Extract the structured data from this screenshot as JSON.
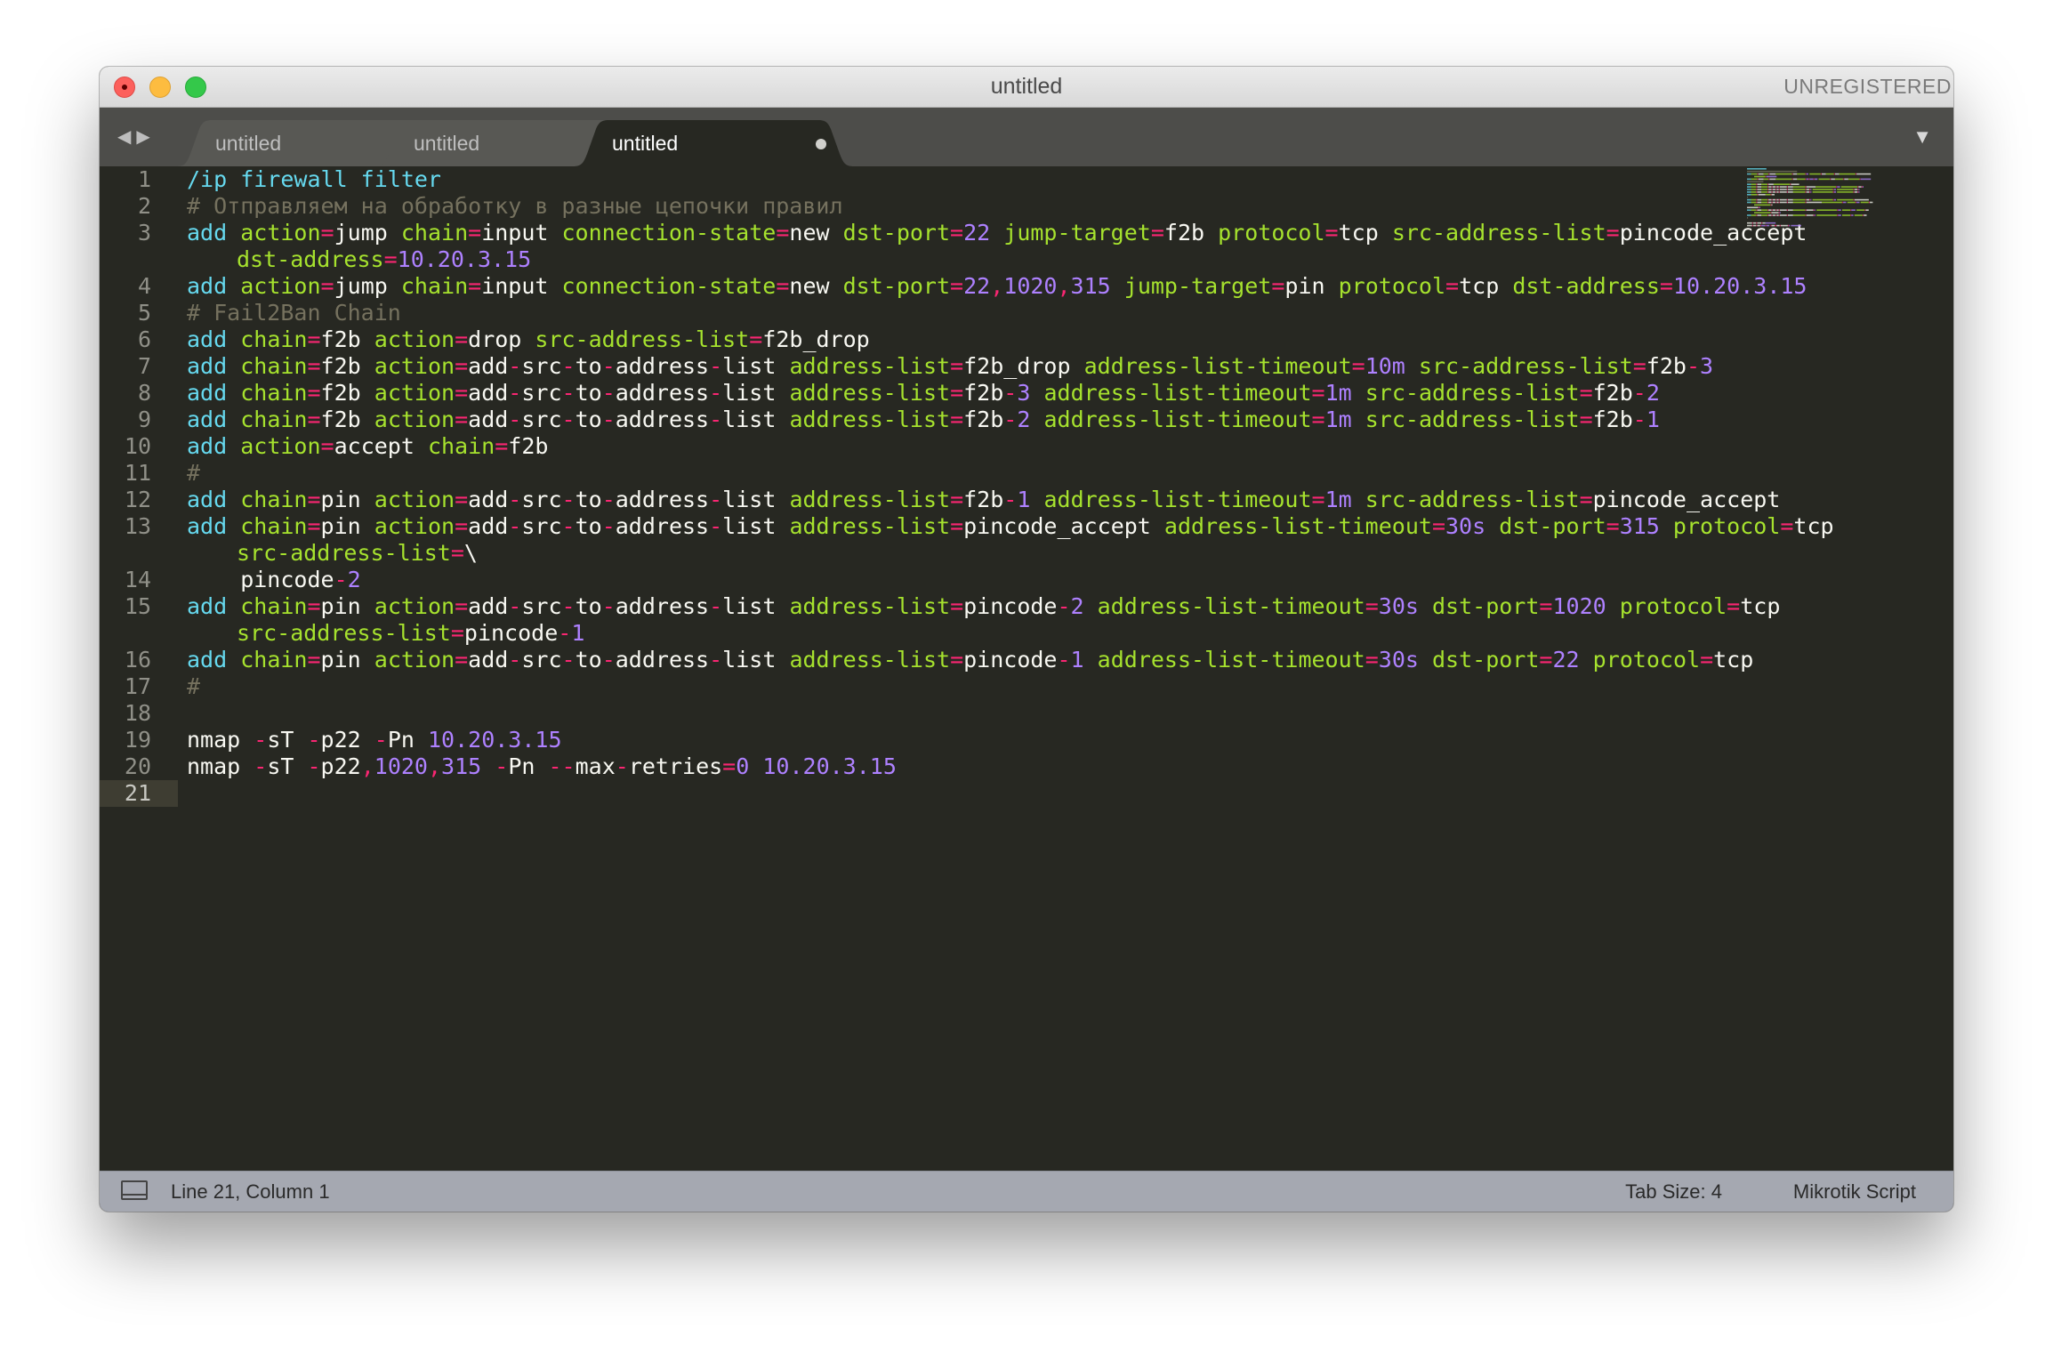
{
  "window": {
    "title": "untitled",
    "unregistered_label": "UNREGISTERED"
  },
  "tabs": [
    {
      "label": "untitled",
      "active": false,
      "modified": true
    },
    {
      "label": "untitled",
      "active": false,
      "modified": true
    },
    {
      "label": "untitled",
      "active": true,
      "modified": true
    }
  ],
  "editor": {
    "line_numbers": [
      "1",
      "2",
      "3",
      "4",
      "5",
      "6",
      "7",
      "8",
      "9",
      "10",
      "11",
      "12",
      "13",
      "14",
      "15",
      "16",
      "17",
      "18",
      "19",
      "20",
      "21"
    ],
    "current_line": "21",
    "lines": [
      [
        [
          "kw",
          "/ip firewall filter"
        ]
      ],
      [
        [
          "cmt",
          "# Отправляем на обработку в разные цепочки правил"
        ]
      ],
      [
        [
          "kw",
          "add "
        ],
        [
          "pr",
          "action"
        ],
        [
          "op",
          "="
        ],
        [
          "txt",
          "jump "
        ],
        [
          "pr",
          "chain"
        ],
        [
          "op",
          "="
        ],
        [
          "txt",
          "input "
        ],
        [
          "pr",
          "connection-state"
        ],
        [
          "op",
          "="
        ],
        [
          "txt",
          "new "
        ],
        [
          "pr",
          "dst-port"
        ],
        [
          "op",
          "="
        ],
        [
          "num",
          "22"
        ],
        [
          "txt",
          " "
        ],
        [
          "pr",
          "jump-target"
        ],
        [
          "op",
          "="
        ],
        [
          "txt",
          "f2b "
        ],
        [
          "pr",
          "protocol"
        ],
        [
          "op",
          "="
        ],
        [
          "txt",
          "tcp "
        ],
        [
          "pr",
          "src-address-list"
        ],
        [
          "op",
          "="
        ],
        [
          "txt",
          "pincode_accept"
        ],
        [
          "br",
          ""
        ],
        [
          "pr",
          "dst-address"
        ],
        [
          "op",
          "="
        ],
        [
          "num",
          "10.20.3.15"
        ]
      ],
      [
        [
          "kw",
          "add "
        ],
        [
          "pr",
          "action"
        ],
        [
          "op",
          "="
        ],
        [
          "txt",
          "jump "
        ],
        [
          "pr",
          "chain"
        ],
        [
          "op",
          "="
        ],
        [
          "txt",
          "input "
        ],
        [
          "pr",
          "connection-state"
        ],
        [
          "op",
          "="
        ],
        [
          "txt",
          "new "
        ],
        [
          "pr",
          "dst-port"
        ],
        [
          "op",
          "="
        ],
        [
          "num",
          "22"
        ],
        [
          "op",
          ","
        ],
        [
          "num",
          "1020"
        ],
        [
          "op",
          ","
        ],
        [
          "num",
          "315"
        ],
        [
          "txt",
          " "
        ],
        [
          "pr",
          "jump-target"
        ],
        [
          "op",
          "="
        ],
        [
          "txt",
          "pin "
        ],
        [
          "pr",
          "protocol"
        ],
        [
          "op",
          "="
        ],
        [
          "txt",
          "tcp "
        ],
        [
          "pr",
          "dst-address"
        ],
        [
          "op",
          "="
        ],
        [
          "num",
          "10.20.3.15"
        ]
      ],
      [
        [
          "cmt",
          "# Fail2Ban Chain"
        ]
      ],
      [
        [
          "kw",
          "add "
        ],
        [
          "pr",
          "chain"
        ],
        [
          "op",
          "="
        ],
        [
          "txt",
          "f2b "
        ],
        [
          "pr",
          "action"
        ],
        [
          "op",
          "="
        ],
        [
          "txt",
          "drop "
        ],
        [
          "pr",
          "src-address-list"
        ],
        [
          "op",
          "="
        ],
        [
          "txt",
          "f2b_drop"
        ]
      ],
      [
        [
          "kw",
          "add "
        ],
        [
          "pr",
          "chain"
        ],
        [
          "op",
          "="
        ],
        [
          "txt",
          "f2b "
        ],
        [
          "pr",
          "action"
        ],
        [
          "op",
          "="
        ],
        [
          "txt",
          "add"
        ],
        [
          "op",
          "-"
        ],
        [
          "txt",
          "src"
        ],
        [
          "op",
          "-"
        ],
        [
          "txt",
          "to"
        ],
        [
          "op",
          "-"
        ],
        [
          "txt",
          "address"
        ],
        [
          "op",
          "-"
        ],
        [
          "txt",
          "list "
        ],
        [
          "pr",
          "address-list"
        ],
        [
          "op",
          "="
        ],
        [
          "txt",
          "f2b_drop "
        ],
        [
          "pr",
          "address-list-timeout"
        ],
        [
          "op",
          "="
        ],
        [
          "num",
          "10m"
        ],
        [
          "txt",
          " "
        ],
        [
          "pr",
          "src-address-list"
        ],
        [
          "op",
          "="
        ],
        [
          "txt",
          "f2b"
        ],
        [
          "op",
          "-"
        ],
        [
          "num",
          "3"
        ]
      ],
      [
        [
          "kw",
          "add "
        ],
        [
          "pr",
          "chain"
        ],
        [
          "op",
          "="
        ],
        [
          "txt",
          "f2b "
        ],
        [
          "pr",
          "action"
        ],
        [
          "op",
          "="
        ],
        [
          "txt",
          "add"
        ],
        [
          "op",
          "-"
        ],
        [
          "txt",
          "src"
        ],
        [
          "op",
          "-"
        ],
        [
          "txt",
          "to"
        ],
        [
          "op",
          "-"
        ],
        [
          "txt",
          "address"
        ],
        [
          "op",
          "-"
        ],
        [
          "txt",
          "list "
        ],
        [
          "pr",
          "address-list"
        ],
        [
          "op",
          "="
        ],
        [
          "txt",
          "f2b"
        ],
        [
          "op",
          "-"
        ],
        [
          "num",
          "3"
        ],
        [
          "txt",
          " "
        ],
        [
          "pr",
          "address-list-timeout"
        ],
        [
          "op",
          "="
        ],
        [
          "num",
          "1m"
        ],
        [
          "txt",
          " "
        ],
        [
          "pr",
          "src-address-list"
        ],
        [
          "op",
          "="
        ],
        [
          "txt",
          "f2b"
        ],
        [
          "op",
          "-"
        ],
        [
          "num",
          "2"
        ]
      ],
      [
        [
          "kw",
          "add "
        ],
        [
          "pr",
          "chain"
        ],
        [
          "op",
          "="
        ],
        [
          "txt",
          "f2b "
        ],
        [
          "pr",
          "action"
        ],
        [
          "op",
          "="
        ],
        [
          "txt",
          "add"
        ],
        [
          "op",
          "-"
        ],
        [
          "txt",
          "src"
        ],
        [
          "op",
          "-"
        ],
        [
          "txt",
          "to"
        ],
        [
          "op",
          "-"
        ],
        [
          "txt",
          "address"
        ],
        [
          "op",
          "-"
        ],
        [
          "txt",
          "list "
        ],
        [
          "pr",
          "address-list"
        ],
        [
          "op",
          "="
        ],
        [
          "txt",
          "f2b"
        ],
        [
          "op",
          "-"
        ],
        [
          "num",
          "2"
        ],
        [
          "txt",
          " "
        ],
        [
          "pr",
          "address-list-timeout"
        ],
        [
          "op",
          "="
        ],
        [
          "num",
          "1m"
        ],
        [
          "txt",
          " "
        ],
        [
          "pr",
          "src-address-list"
        ],
        [
          "op",
          "="
        ],
        [
          "txt",
          "f2b"
        ],
        [
          "op",
          "-"
        ],
        [
          "num",
          "1"
        ]
      ],
      [
        [
          "kw",
          "add "
        ],
        [
          "pr",
          "action"
        ],
        [
          "op",
          "="
        ],
        [
          "txt",
          "accept "
        ],
        [
          "pr",
          "chain"
        ],
        [
          "op",
          "="
        ],
        [
          "txt",
          "f2b"
        ]
      ],
      [
        [
          "cmt",
          "#"
        ]
      ],
      [
        [
          "kw",
          "add "
        ],
        [
          "pr",
          "chain"
        ],
        [
          "op",
          "="
        ],
        [
          "txt",
          "pin "
        ],
        [
          "pr",
          "action"
        ],
        [
          "op",
          "="
        ],
        [
          "txt",
          "add"
        ],
        [
          "op",
          "-"
        ],
        [
          "txt",
          "src"
        ],
        [
          "op",
          "-"
        ],
        [
          "txt",
          "to"
        ],
        [
          "op",
          "-"
        ],
        [
          "txt",
          "address"
        ],
        [
          "op",
          "-"
        ],
        [
          "txt",
          "list "
        ],
        [
          "pr",
          "address-list"
        ],
        [
          "op",
          "="
        ],
        [
          "txt",
          "f2b"
        ],
        [
          "op",
          "-"
        ],
        [
          "num",
          "1"
        ],
        [
          "txt",
          " "
        ],
        [
          "pr",
          "address-list-timeout"
        ],
        [
          "op",
          "="
        ],
        [
          "num",
          "1m"
        ],
        [
          "txt",
          " "
        ],
        [
          "pr",
          "src-address-list"
        ],
        [
          "op",
          "="
        ],
        [
          "txt",
          "pincode_accept"
        ]
      ],
      [
        [
          "kw",
          "add "
        ],
        [
          "pr",
          "chain"
        ],
        [
          "op",
          "="
        ],
        [
          "txt",
          "pin "
        ],
        [
          "pr",
          "action"
        ],
        [
          "op",
          "="
        ],
        [
          "txt",
          "add"
        ],
        [
          "op",
          "-"
        ],
        [
          "txt",
          "src"
        ],
        [
          "op",
          "-"
        ],
        [
          "txt",
          "to"
        ],
        [
          "op",
          "-"
        ],
        [
          "txt",
          "address"
        ],
        [
          "op",
          "-"
        ],
        [
          "txt",
          "list "
        ],
        [
          "pr",
          "address-list"
        ],
        [
          "op",
          "="
        ],
        [
          "txt",
          "pincode_accept "
        ],
        [
          "pr",
          "address-list-timeout"
        ],
        [
          "op",
          "="
        ],
        [
          "num",
          "30s"
        ],
        [
          "txt",
          " "
        ],
        [
          "pr",
          "dst-port"
        ],
        [
          "op",
          "="
        ],
        [
          "num",
          "315"
        ],
        [
          "txt",
          " "
        ],
        [
          "pr",
          "protocol"
        ],
        [
          "op",
          "="
        ],
        [
          "txt",
          "tcp"
        ],
        [
          "br",
          ""
        ],
        [
          "pr",
          "src-address-list"
        ],
        [
          "op",
          "="
        ],
        [
          "txt",
          "\\"
        ]
      ],
      [
        [
          "txt",
          "    pincode"
        ],
        [
          "op",
          "-"
        ],
        [
          "num",
          "2"
        ]
      ],
      [
        [
          "kw",
          "add "
        ],
        [
          "pr",
          "chain"
        ],
        [
          "op",
          "="
        ],
        [
          "txt",
          "pin "
        ],
        [
          "pr",
          "action"
        ],
        [
          "op",
          "="
        ],
        [
          "txt",
          "add"
        ],
        [
          "op",
          "-"
        ],
        [
          "txt",
          "src"
        ],
        [
          "op",
          "-"
        ],
        [
          "txt",
          "to"
        ],
        [
          "op",
          "-"
        ],
        [
          "txt",
          "address"
        ],
        [
          "op",
          "-"
        ],
        [
          "txt",
          "list "
        ],
        [
          "pr",
          "address-list"
        ],
        [
          "op",
          "="
        ],
        [
          "txt",
          "pincode"
        ],
        [
          "op",
          "-"
        ],
        [
          "num",
          "2"
        ],
        [
          "txt",
          " "
        ],
        [
          "pr",
          "address-list-timeout"
        ],
        [
          "op",
          "="
        ],
        [
          "num",
          "30s"
        ],
        [
          "txt",
          " "
        ],
        [
          "pr",
          "dst-port"
        ],
        [
          "op",
          "="
        ],
        [
          "num",
          "1020"
        ],
        [
          "txt",
          " "
        ],
        [
          "pr",
          "protocol"
        ],
        [
          "op",
          "="
        ],
        [
          "txt",
          "tcp"
        ],
        [
          "br",
          ""
        ],
        [
          "pr",
          "src-address-list"
        ],
        [
          "op",
          "="
        ],
        [
          "txt",
          "pincode"
        ],
        [
          "op",
          "-"
        ],
        [
          "num",
          "1"
        ]
      ],
      [
        [
          "kw",
          "add "
        ],
        [
          "pr",
          "chain"
        ],
        [
          "op",
          "="
        ],
        [
          "txt",
          "pin "
        ],
        [
          "pr",
          "action"
        ],
        [
          "op",
          "="
        ],
        [
          "txt",
          "add"
        ],
        [
          "op",
          "-"
        ],
        [
          "txt",
          "src"
        ],
        [
          "op",
          "-"
        ],
        [
          "txt",
          "to"
        ],
        [
          "op",
          "-"
        ],
        [
          "txt",
          "address"
        ],
        [
          "op",
          "-"
        ],
        [
          "txt",
          "list "
        ],
        [
          "pr",
          "address-list"
        ],
        [
          "op",
          "="
        ],
        [
          "txt",
          "pincode"
        ],
        [
          "op",
          "-"
        ],
        [
          "num",
          "1"
        ],
        [
          "txt",
          " "
        ],
        [
          "pr",
          "address-list-timeout"
        ],
        [
          "op",
          "="
        ],
        [
          "num",
          "30s"
        ],
        [
          "txt",
          " "
        ],
        [
          "pr",
          "dst-port"
        ],
        [
          "op",
          "="
        ],
        [
          "num",
          "22"
        ],
        [
          "txt",
          " "
        ],
        [
          "pr",
          "protocol"
        ],
        [
          "op",
          "="
        ],
        [
          "txt",
          "tcp"
        ]
      ],
      [
        [
          "cmt",
          "#"
        ]
      ],
      [],
      [
        [
          "txt",
          "nmap "
        ],
        [
          "op",
          "-"
        ],
        [
          "txt",
          "sT "
        ],
        [
          "op",
          "-"
        ],
        [
          "txt",
          "p22 "
        ],
        [
          "op",
          "-"
        ],
        [
          "txt",
          "Pn "
        ],
        [
          "num",
          "10.20.3.15"
        ]
      ],
      [
        [
          "txt",
          "nmap "
        ],
        [
          "op",
          "-"
        ],
        [
          "txt",
          "sT "
        ],
        [
          "op",
          "-"
        ],
        [
          "txt",
          "p22"
        ],
        [
          "op",
          ","
        ],
        [
          "num",
          "1020"
        ],
        [
          "op",
          ","
        ],
        [
          "num",
          "315"
        ],
        [
          "txt",
          " "
        ],
        [
          "op",
          "-"
        ],
        [
          "txt",
          "Pn "
        ],
        [
          "op",
          "--"
        ],
        [
          "txt",
          "max"
        ],
        [
          "op",
          "-"
        ],
        [
          "txt",
          "retries"
        ],
        [
          "op",
          "="
        ],
        [
          "num",
          "0"
        ],
        [
          "txt",
          " "
        ],
        [
          "num",
          "10.20.3.15"
        ]
      ],
      []
    ]
  },
  "statusbar": {
    "position": "Line 21, Column 1",
    "tab_size": "Tab Size: 4",
    "syntax": "Mikrotik Script"
  },
  "icons": {
    "back": "back-arrow-icon",
    "forward": "forward-arrow-icon",
    "tab_menu": "chevron-down-icon",
    "panel": "panel-toggle-icon"
  },
  "colors": {
    "editor_bg": "#272822",
    "keyword": "#66d9ef",
    "comment": "#75715e",
    "property": "#a6e22e",
    "operator": "#f92672",
    "number": "#ae81ff",
    "text": "#f8f8f2"
  }
}
